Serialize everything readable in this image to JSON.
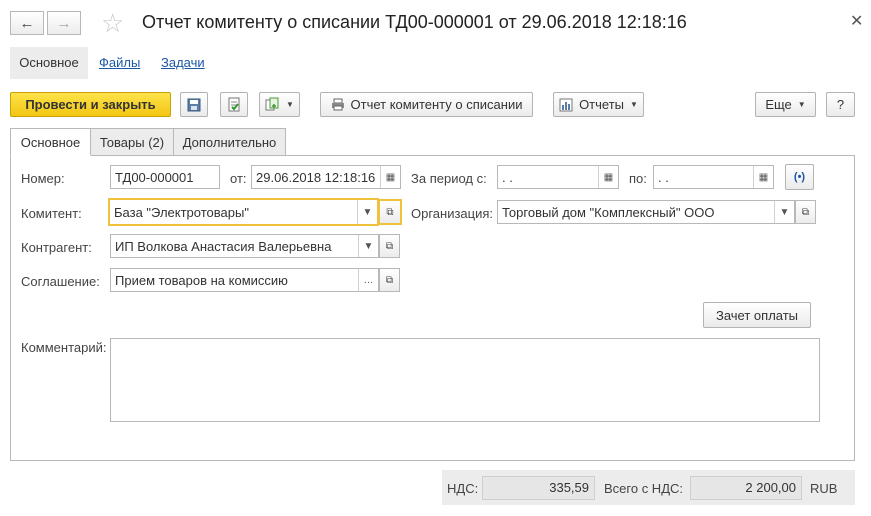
{
  "window": {
    "title": "Отчет комитенту о списании ТД00-000001 от 29.06.2018 12:18:16",
    "back_icon": "arrow-left",
    "forward_icon": "arrow-right",
    "favorite_icon": "star",
    "close_icon": "close"
  },
  "section_tabs": {
    "main": "Основное",
    "files": "Файлы",
    "tasks": "Задачи"
  },
  "toolbar": {
    "post_close": "Провести и закрыть",
    "report_button": "Отчет комитенту о списании",
    "reports_menu": "Отчеты",
    "more_menu": "Еще",
    "help": "?"
  },
  "form_tabs": {
    "main": "Основное",
    "goods": "Товары (2)",
    "extra": "Дополнительно"
  },
  "form": {
    "number_label": "Номер:",
    "number_value": "ТД00-000001",
    "date_label": "от:",
    "date_value": "29.06.2018 12:18:16",
    "period_from_label": "За период с:",
    "period_from_value": " .  .",
    "period_to_label": "по:",
    "period_to_value": " .  .",
    "consignor_label": "Комитент:",
    "consignor_value": "База \"Электротовары\"",
    "organization_label": "Организация:",
    "organization_value": "Торговый дом \"Комплексный\" ООО",
    "counterparty_label": "Контрагент:",
    "counterparty_value": "ИП Волкова Анастасия Валерьевна",
    "agreement_label": "Соглашение:",
    "agreement_value": "Прием товаров на комиссию",
    "payment_offset_button": "Зачет оплаты",
    "comment_label": "Комментарий:",
    "comment_value": ""
  },
  "footer": {
    "vat_label": "НДС:",
    "vat_value": "335,59",
    "total_label": "Всего с НДС:",
    "total_value": "2 200,00",
    "currency": "RUB"
  }
}
